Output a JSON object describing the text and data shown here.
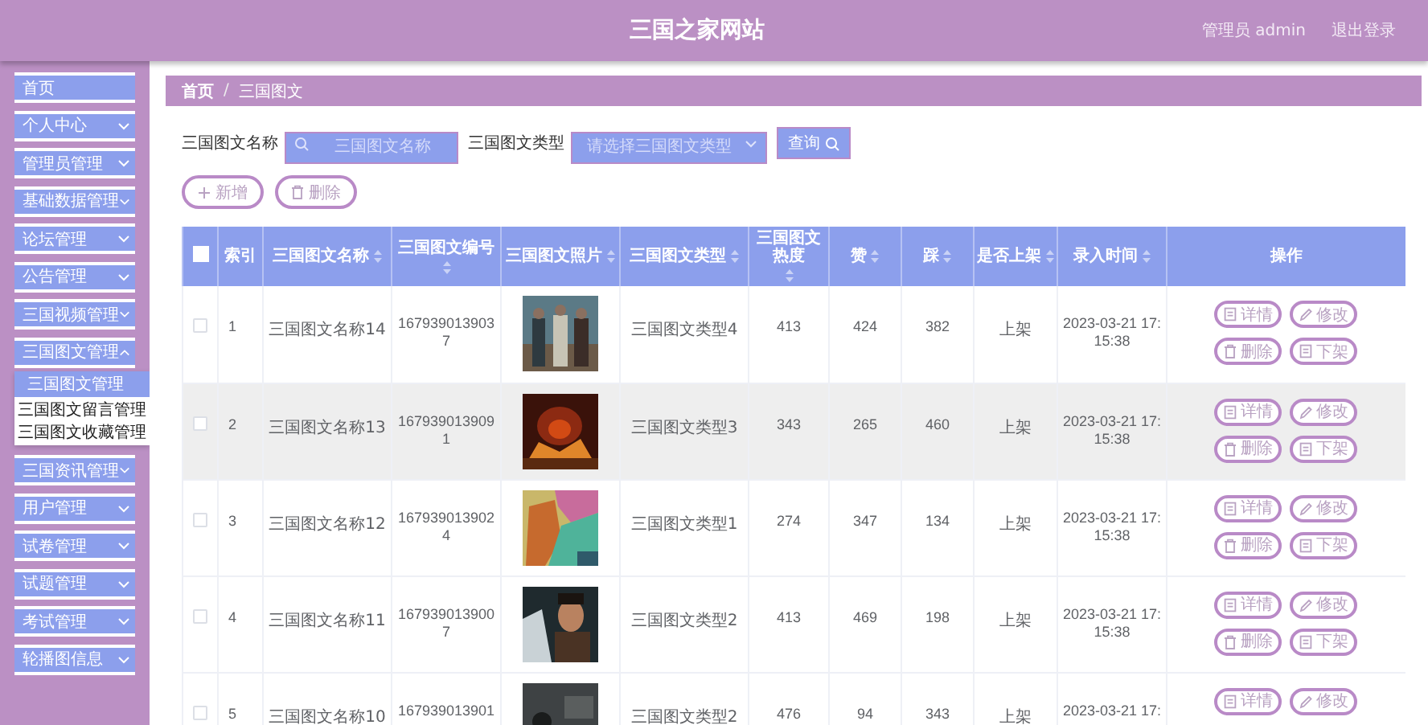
{
  "header": {
    "title": "三国之家网站",
    "user": "管理员 admin",
    "logout": "退出登录"
  },
  "sidebar": {
    "items": [
      {
        "label": "首页",
        "kind": "link"
      },
      {
        "label": "个人中心",
        "kind": "menu",
        "expanded": false
      },
      {
        "label": "管理员管理",
        "kind": "menu",
        "expanded": false
      },
      {
        "label": "基础数据管理",
        "kind": "menu",
        "expanded": false
      },
      {
        "label": "论坛管理",
        "kind": "menu",
        "expanded": false
      },
      {
        "label": "公告管理",
        "kind": "menu",
        "expanded": false
      },
      {
        "label": "三国视频管理",
        "kind": "menu",
        "expanded": false
      },
      {
        "label": "三国图文管理",
        "kind": "menu",
        "expanded": true,
        "children": [
          {
            "label": "三国图文管理",
            "selected": true
          },
          {
            "label": "三国图文留言管理",
            "selected": false
          },
          {
            "label": "三国图文收藏管理",
            "selected": false
          }
        ]
      },
      {
        "label": "三国资讯管理",
        "kind": "menu",
        "expanded": false
      },
      {
        "label": "用户管理",
        "kind": "menu",
        "expanded": false
      },
      {
        "label": "试卷管理",
        "kind": "menu",
        "expanded": false
      },
      {
        "label": "试题管理",
        "kind": "menu",
        "expanded": false
      },
      {
        "label": "考试管理",
        "kind": "menu",
        "expanded": false
      },
      {
        "label": "轮播图信息",
        "kind": "menu",
        "expanded": false
      }
    ]
  },
  "breadcrumb": {
    "items": [
      "首页",
      "三国图文"
    ],
    "separator": "/"
  },
  "search": {
    "name_label": "三国图文名称",
    "name_placeholder": "三国图文名称",
    "type_label": "三国图文类型",
    "type_placeholder": "请选择三国图文类型",
    "query_button": "查询"
  },
  "actions": [
    {
      "kind": "add",
      "label": "新增"
    },
    {
      "kind": "delete",
      "label": "删除"
    }
  ],
  "table": {
    "select_all": {
      "checked": false
    },
    "columns": [
      {
        "label": "索引",
        "sortable": false
      },
      {
        "label": "三国图文名称",
        "sortable": true
      },
      {
        "label": "三国图文编号",
        "sortable": true
      },
      {
        "label": "三国图文照片",
        "sortable": true
      },
      {
        "label": "三国图文类型",
        "sortable": true
      },
      {
        "label": "三国图文热度",
        "sortable": true
      },
      {
        "label": "赞",
        "sortable": true
      },
      {
        "label": "踩",
        "sortable": true
      },
      {
        "label": "是否上架",
        "sortable": true
      },
      {
        "label": "录入时间",
        "sortable": true
      },
      {
        "label": "操作",
        "sortable": false
      }
    ],
    "rows": [
      {
        "checked": false,
        "highlighted": false,
        "index": "1",
        "name": "三国图文名称14",
        "code": "1679390139037",
        "image": {
          "kind": "picture"
        },
        "type": "三国图文类型4",
        "heat": "413",
        "likes": "424",
        "dislikes": "382",
        "status": "上架",
        "time": "2023-03-21 17:15:38",
        "buttons": [
          {
            "kind": "detail",
            "label": "详情"
          },
          {
            "kind": "edit",
            "label": "修改"
          },
          {
            "kind": "delete",
            "label": "删除"
          },
          {
            "kind": "unlist",
            "label": "下架"
          }
        ]
      },
      {
        "checked": false,
        "highlighted": true,
        "index": "2",
        "name": "三国图文名称13",
        "code": "1679390139091",
        "image": {
          "kind": "picture"
        },
        "type": "三国图文类型3",
        "heat": "343",
        "likes": "265",
        "dislikes": "460",
        "status": "上架",
        "time": "2023-03-21 17:15:38",
        "buttons": [
          {
            "kind": "detail",
            "label": "详情"
          },
          {
            "kind": "edit",
            "label": "修改"
          },
          {
            "kind": "delete",
            "label": "删除"
          },
          {
            "kind": "unlist",
            "label": "下架"
          }
        ]
      },
      {
        "checked": false,
        "highlighted": false,
        "index": "3",
        "name": "三国图文名称12",
        "code": "1679390139024",
        "image": {
          "kind": "picture"
        },
        "type": "三国图文类型1",
        "heat": "274",
        "likes": "347",
        "dislikes": "134",
        "status": "上架",
        "time": "2023-03-21 17:15:38",
        "buttons": [
          {
            "kind": "detail",
            "label": "详情"
          },
          {
            "kind": "edit",
            "label": "修改"
          },
          {
            "kind": "delete",
            "label": "删除"
          },
          {
            "kind": "unlist",
            "label": "下架"
          }
        ]
      },
      {
        "checked": false,
        "highlighted": false,
        "index": "4",
        "name": "三国图文名称11",
        "code": "1679390139007",
        "image": {
          "kind": "picture"
        },
        "type": "三国图文类型2",
        "heat": "413",
        "likes": "469",
        "dislikes": "198",
        "status": "上架",
        "time": "2023-03-21 17:15:38",
        "buttons": [
          {
            "kind": "detail",
            "label": "详情"
          },
          {
            "kind": "edit",
            "label": "修改"
          },
          {
            "kind": "delete",
            "label": "删除"
          },
          {
            "kind": "unlist",
            "label": "下架"
          }
        ]
      },
      {
        "checked": false,
        "highlighted": false,
        "index": "5",
        "name": "三国图文名称10",
        "code": "167939013901",
        "image": {
          "kind": "picture"
        },
        "type": "三国图文类型2",
        "heat": "476",
        "likes": "94",
        "dislikes": "343",
        "status": "上架",
        "time": "2023-03-21 17:",
        "buttons": [
          {
            "kind": "detail",
            "label": "详情"
          },
          {
            "kind": "edit",
            "label": "修改"
          }
        ]
      }
    ]
  }
}
